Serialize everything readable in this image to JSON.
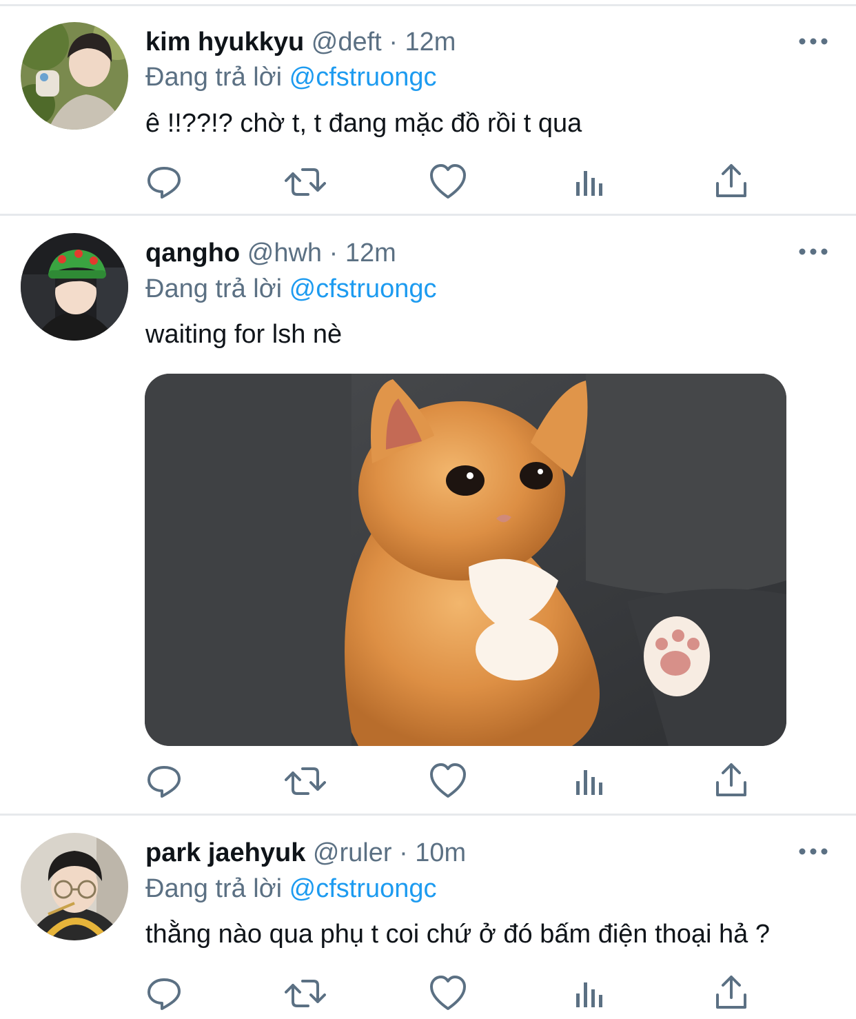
{
  "reply_prefix": "Đang trả lời",
  "colors": {
    "accent": "#1d9bf0",
    "secondary": "#5b7083",
    "text": "#0f1419",
    "divider": "#e6e9ec"
  },
  "tweets": [
    {
      "display_name": "kim hyukkyu",
      "handle": "@deft",
      "separator": "·",
      "time": "12m",
      "reply_to": "@cfstruongc",
      "text": "ê !!??!? chờ t, t đang mặc đồ rồi t qua",
      "has_media": false
    },
    {
      "display_name": "qangho",
      "handle": "@hwh",
      "separator": "·",
      "time": "12m",
      "reply_to": "@cfstruongc",
      "text": "waiting for lsh nè",
      "has_media": true
    },
    {
      "display_name": "park jaehyuk",
      "handle": "@ruler",
      "separator": "·",
      "time": "10m",
      "reply_to": "@cfstruongc",
      "text": "thằng nào qua phụ t coi chứ ở đó bấm điện thoại hả ?",
      "has_media": false
    }
  ],
  "action_icons": [
    "reply-icon",
    "retweet-icon",
    "like-icon",
    "analytics-icon",
    "share-icon"
  ]
}
